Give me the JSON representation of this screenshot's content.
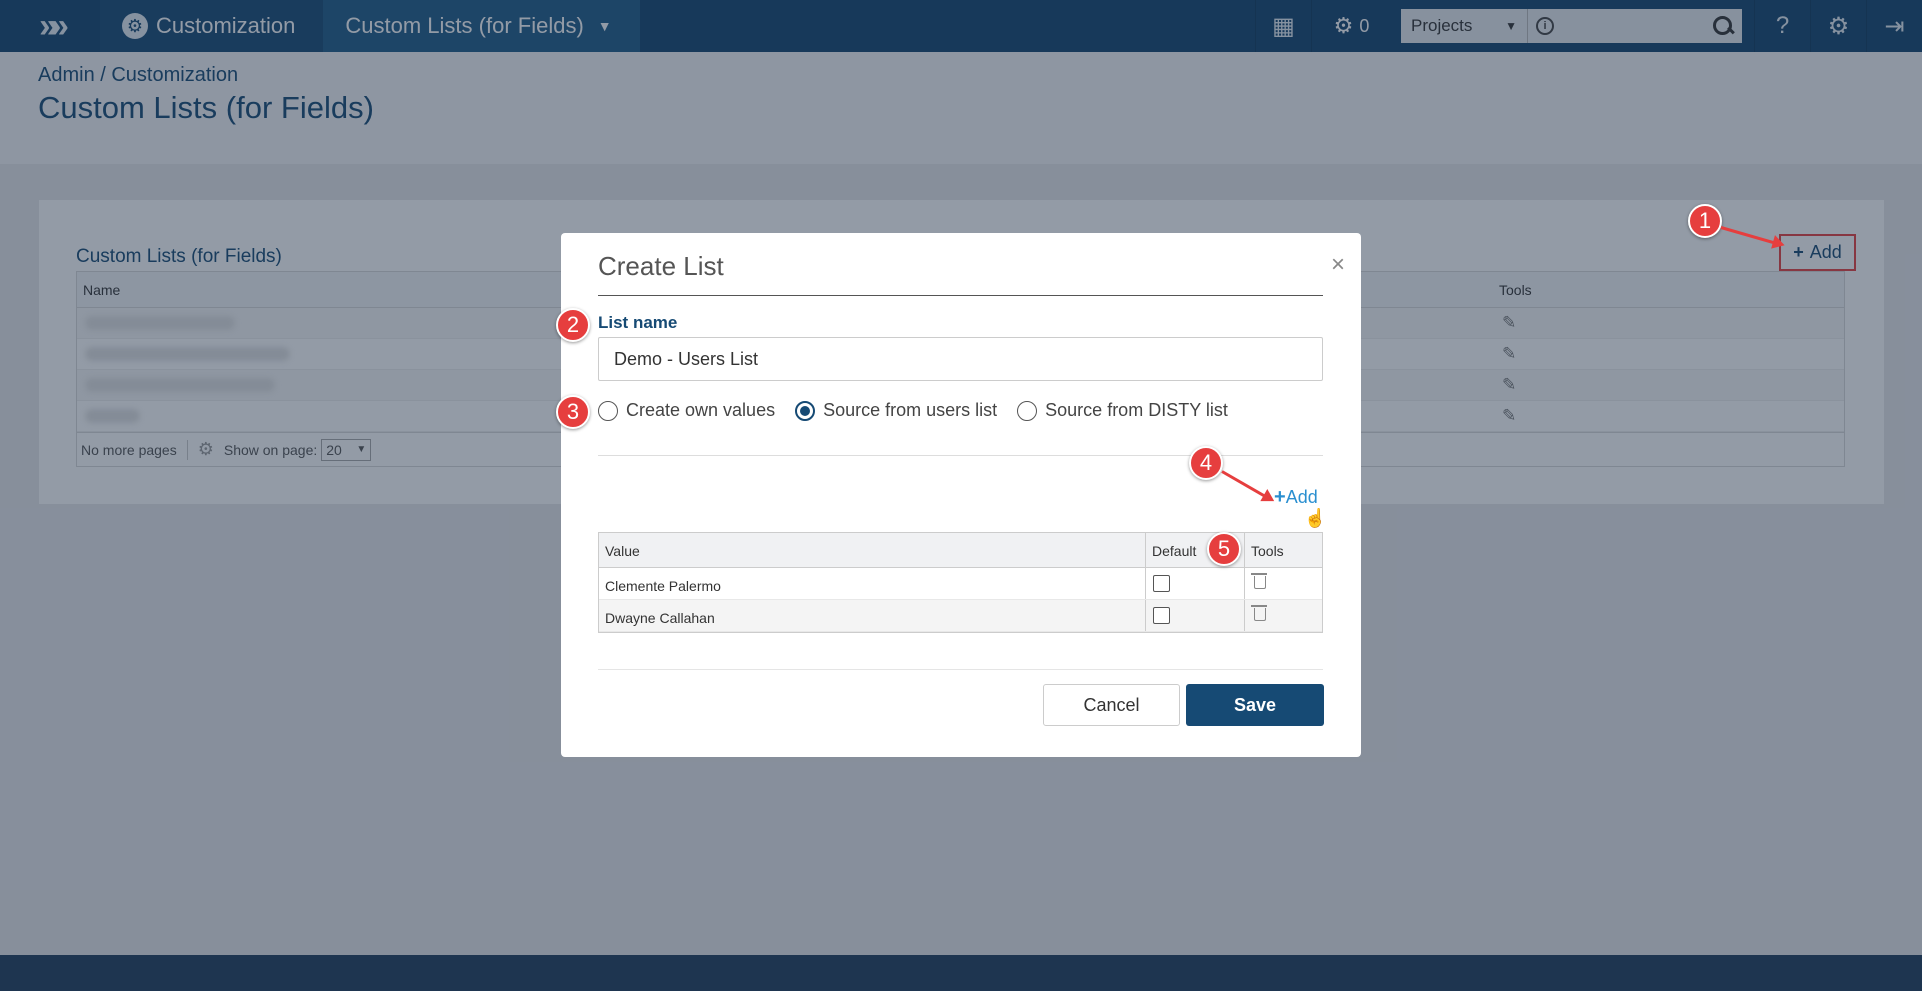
{
  "topnav": {
    "crumbs": [
      "Customization",
      "Custom Lists (for Fields)"
    ],
    "jobs_count": "0",
    "project_select": "Projects"
  },
  "header": {
    "breadcrumb": "Admin / Customization",
    "title": "Custom Lists (for Fields)"
  },
  "card": {
    "title": "Custom Lists (for Fields)",
    "add_label": "Add",
    "columns": [
      "Name",
      "Tools"
    ],
    "footer": {
      "no_more_pages": "No more pages",
      "show_on_page_label": "Show on page:",
      "page_size": "20"
    }
  },
  "modal": {
    "title": "Create List",
    "close": "×",
    "list_name_label": "List name",
    "list_name_value": "Demo - Users List",
    "radio_options": [
      "Create own values",
      "Source from users list",
      "Source from DISTY list"
    ],
    "selected_option": "Source from users list",
    "add_label": "Add",
    "table": {
      "columns": [
        "Value",
        "Default",
        "Tools"
      ],
      "rows": [
        {
          "value": "Clemente Palermo",
          "default": false
        },
        {
          "value": "Dwayne Callahan",
          "default": false
        }
      ]
    },
    "cancel_label": "Cancel",
    "save_label": "Save"
  },
  "markers": [
    "1",
    "2",
    "3",
    "4",
    "5"
  ],
  "colors": {
    "nav": "#13446d",
    "primary": "#164a74",
    "marker": "#e63e3e",
    "link": "#2a8fd0"
  }
}
